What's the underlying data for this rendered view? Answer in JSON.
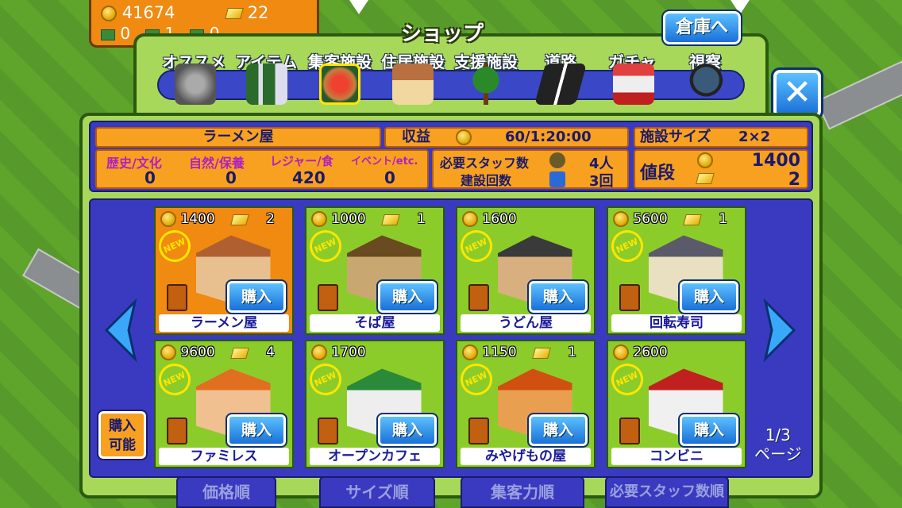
{
  "resources": {
    "coins": "41674",
    "gold": "22",
    "ticket1": "0",
    "ticket5": "1",
    "ticket10": "0"
  },
  "shop": {
    "title": "ショップ",
    "warehouse_label": "倉庫へ",
    "close_label": "✕"
  },
  "categories": [
    "オススメ",
    "アイテム",
    "集客施設",
    "住居施設",
    "支援施設",
    "道路",
    "ガチャ",
    "視察"
  ],
  "info": {
    "name": "ラーメン屋",
    "income_label": "収益",
    "income_value": "60/1:20:00",
    "size_label": "施設サイズ",
    "size_value": "2×2",
    "stat_labels": [
      "歴史/文化",
      "自然/保養",
      "レジャー/食",
      "イベント/etc."
    ],
    "stat_values": [
      "0",
      "0",
      "420",
      "0"
    ],
    "staff_label": "必要スタッフ数",
    "staff_value": "4人",
    "build_label": "建設回数",
    "build_value": "3回",
    "price_label": "値段",
    "price_coins": "1400",
    "price_gold": "2"
  },
  "items": [
    {
      "price": "1400",
      "gold": "2",
      "name": "ラーメン屋",
      "new": true
    },
    {
      "price": "1000",
      "gold": "1",
      "name": "そば屋",
      "new": true
    },
    {
      "price": "1600",
      "gold": "",
      "name": "うどん屋",
      "new": true
    },
    {
      "price": "5600",
      "gold": "1",
      "name": "回転寿司",
      "new": true
    },
    {
      "price": "9600",
      "gold": "4",
      "name": "ファミレス",
      "new": true
    },
    {
      "price": "1700",
      "gold": "",
      "name": "オープンカフェ",
      "new": true
    },
    {
      "price": "1150",
      "gold": "1",
      "name": "みやげもの屋",
      "new": true
    },
    {
      "price": "2600",
      "gold": "",
      "name": "コンビニ",
      "new": true
    }
  ],
  "buy_label": "購入",
  "new_label": "NEW",
  "avail_label": "購入\n可能",
  "page": {
    "current": "1/3",
    "label": "ページ"
  },
  "sort": [
    "価格順",
    "サイズ順",
    "集客力順",
    "必要スタッフ数順"
  ],
  "colors": {
    "accent": "#1a70d8",
    "panel": "#3a3ac0",
    "frame": "#a8d85a",
    "selected": "#f08a10"
  }
}
